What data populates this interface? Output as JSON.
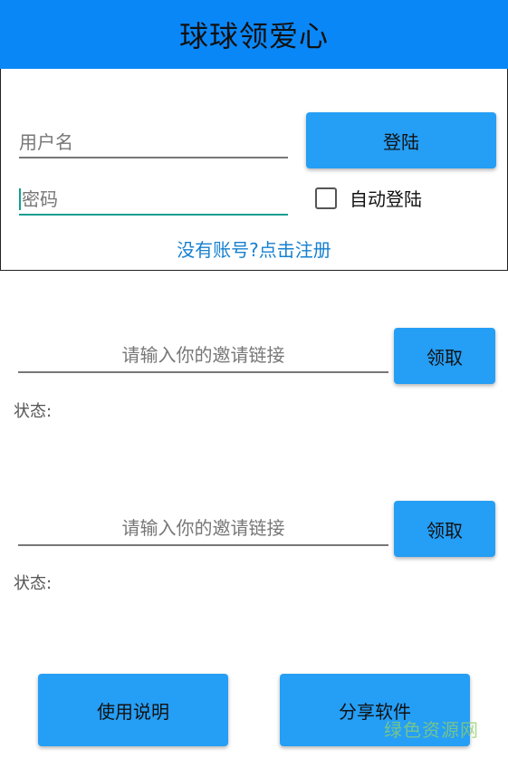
{
  "header": {
    "title": "球球领爱心"
  },
  "login": {
    "username_placeholder": "用户名",
    "password_placeholder": "密码",
    "login_button": "登陆",
    "auto_login_label": "自动登陆",
    "auto_login_checked": false,
    "register_link": "没有账号?点击注册"
  },
  "invites": [
    {
      "placeholder": "请输入你的邀请链接",
      "button": "领取",
      "status_label": "状态:"
    },
    {
      "placeholder": "请输入你的邀请链接",
      "button": "领取",
      "status_label": "状态:"
    }
  ],
  "footer": {
    "instructions_button": "使用说明",
    "share_button": "分享软件"
  },
  "watermark": "绿色资源网",
  "colors": {
    "header_bg": "#0a87f7",
    "button_bg": "#259ef5",
    "link": "#1680d0",
    "focus": "#139e8f"
  }
}
